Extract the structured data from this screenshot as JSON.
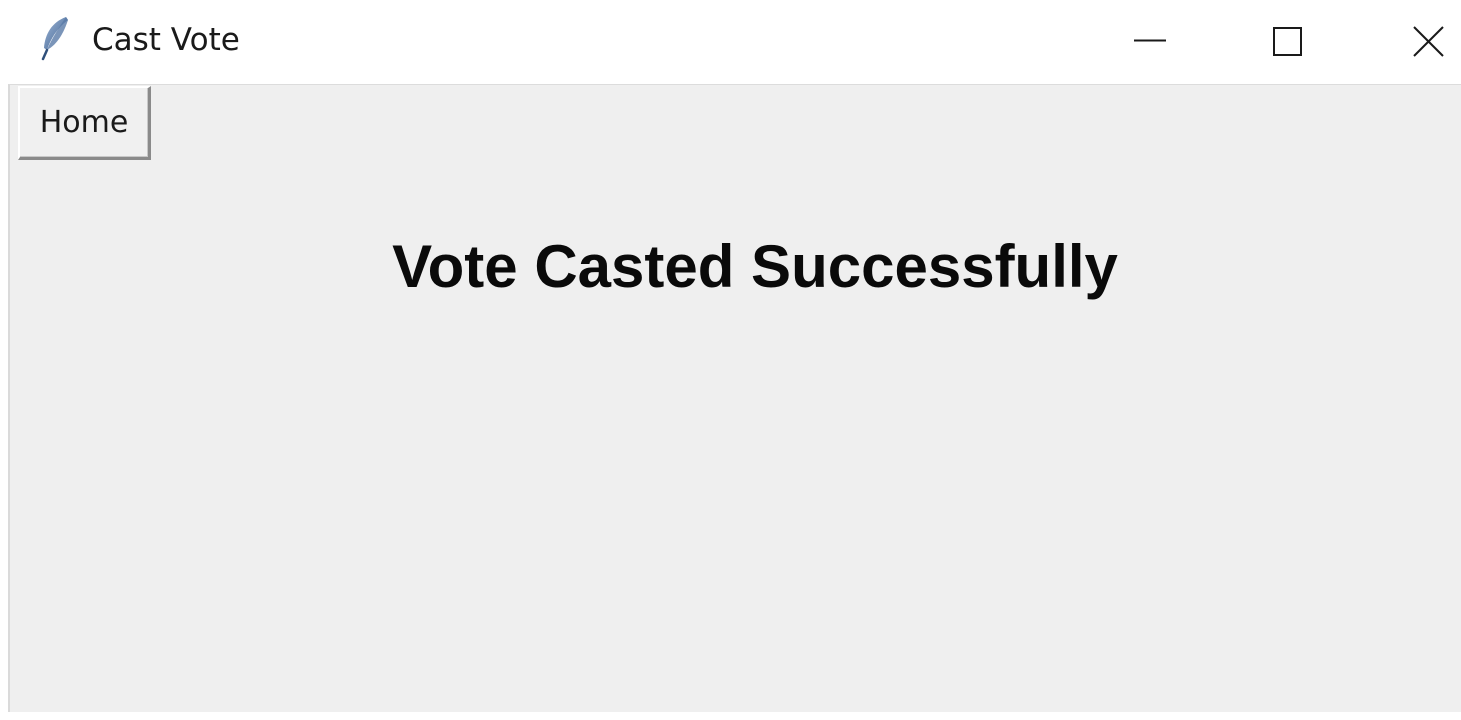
{
  "window": {
    "title": "Cast Vote",
    "icon": "feather-icon",
    "controls": [
      "minimize-icon",
      "maximize-icon",
      "close-icon"
    ]
  },
  "toolbar": {
    "home_label": "Home"
  },
  "main": {
    "message": "Vote Casted Successfully"
  },
  "colors": {
    "background": "#efefef",
    "titlebar": "#ffffff",
    "text": "#0a0a0a"
  }
}
